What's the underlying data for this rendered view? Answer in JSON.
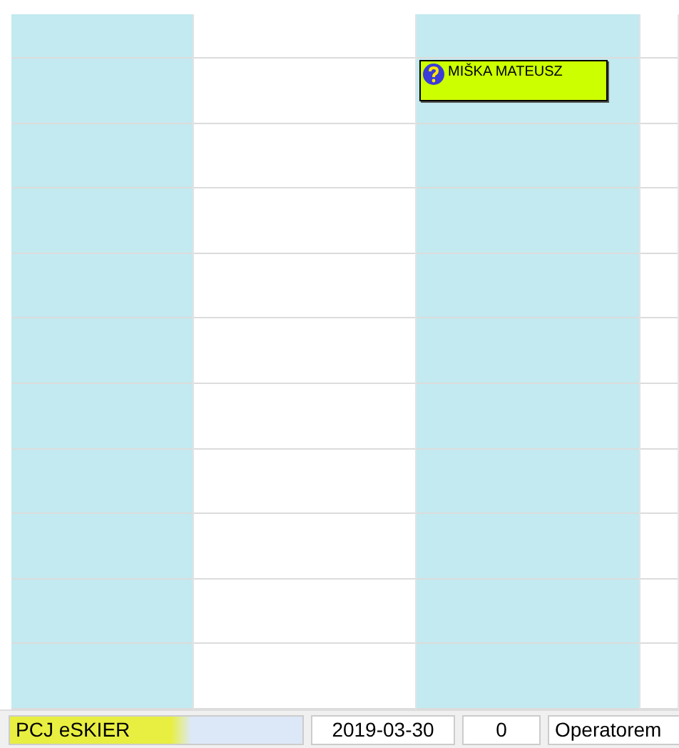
{
  "columns": [
    {
      "shaded": true
    },
    {
      "shaded": false
    },
    {
      "shaded": true,
      "events": [
        {
          "title": "MIŠKA MATEUSZ",
          "color": "#ccff00"
        }
      ]
    },
    {
      "shaded": false
    }
  ],
  "status_bar": {
    "panels": [
      {
        "text": "PCJ eSKIER",
        "highlighted": true
      },
      {
        "text": "2019-03-30"
      },
      {
        "text": "0"
      },
      {
        "text": "Operatorem"
      }
    ]
  }
}
